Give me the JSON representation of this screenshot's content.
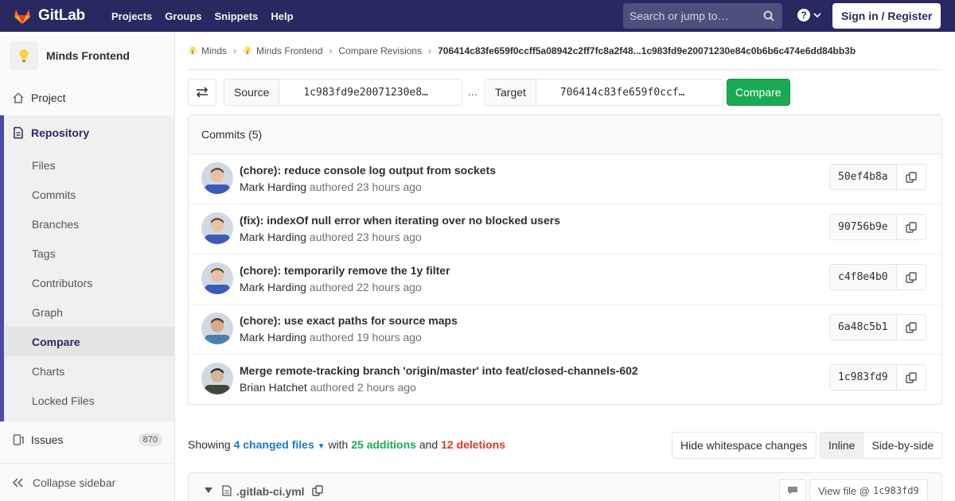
{
  "navbar": {
    "brand": "GitLab",
    "links": [
      "Projects",
      "Groups",
      "Snippets",
      "Help"
    ],
    "search_placeholder": "Search or jump to…",
    "signin": "Sign in / Register",
    "help_glyph": "?",
    "brand_color": "#292961"
  },
  "sidebar": {
    "project_name": "Minds Frontend",
    "project_item": "Project",
    "repository": "Repository",
    "repo_items": [
      "Files",
      "Commits",
      "Branches",
      "Tags",
      "Contributors",
      "Graph",
      "Compare",
      "Charts",
      "Locked Files"
    ],
    "active_item": "Compare",
    "issues": "Issues",
    "issues_count": "870",
    "collapse": "Collapse sidebar"
  },
  "breadcrumb": {
    "group": "Minds",
    "project": "Minds Frontend",
    "section": "Compare Revisions",
    "current": "706414c83fe659f0ccff5a08942c2ff7fc8a2f48...1c983fd9e20071230e84c0b6b6c474e6dd84bb3b"
  },
  "compare": {
    "source_label": "Source",
    "source_value": "1c983fd9e20071230e8…",
    "separator": "...",
    "target_label": "Target",
    "target_value": "706414c83fe659f0ccf…",
    "button": "Compare"
  },
  "commits": {
    "header": "Commits (5)",
    "verb": "authored",
    "items": [
      {
        "title": "(chore): reduce console log output from sockets",
        "author": "Mark Harding",
        "time": "23 hours ago",
        "sha": "50ef4b8a"
      },
      {
        "title": "(fix): indexOf null error when iterating over no blocked users",
        "author": "Mark Harding",
        "time": "23 hours ago",
        "sha": "90756b9e"
      },
      {
        "title": "(chore): temporarily remove the 1y filter",
        "author": "Mark Harding",
        "time": "22 hours ago",
        "sha": "c4f8e4b0"
      },
      {
        "title": "(chore): use exact paths for source maps",
        "author": "Mark Harding",
        "time": "19 hours ago",
        "sha": "6a48c5b1"
      },
      {
        "title": "Merge remote-tracking branch 'origin/master' into feat/closed-channels-602",
        "author": "Brian Hatchet",
        "time": "2 hours ago",
        "sha": "1c983fd9"
      }
    ]
  },
  "summary": {
    "showing": "Showing",
    "changed": "4 changed files",
    "with": "with",
    "additions": "25 additions",
    "and": "and",
    "deletions": "12 deletions",
    "whitespace_btn": "Hide whitespace changes",
    "inline_btn": "Inline",
    "side_btn": "Side-by-side"
  },
  "file": {
    "name": ".gitlab-ci.yml",
    "view_file": "View file @",
    "view_sha": "1c983fd9"
  }
}
